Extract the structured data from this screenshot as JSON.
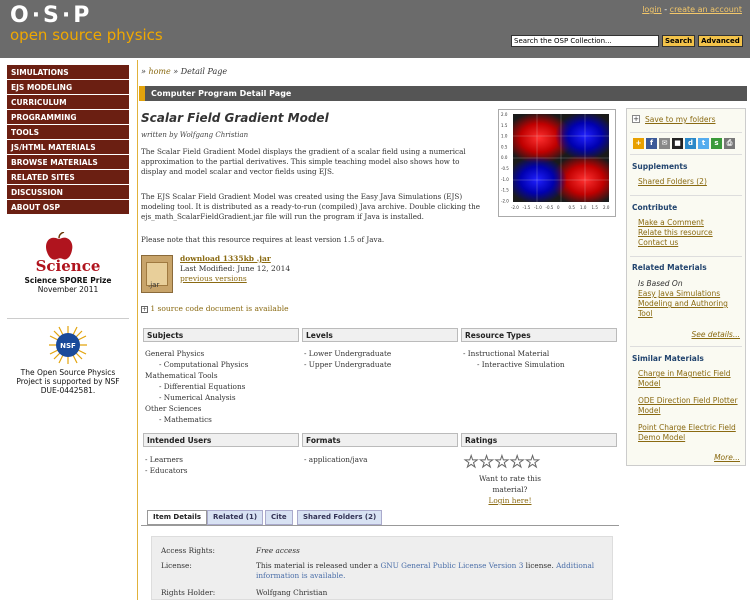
{
  "header": {
    "logo_text": "O·S·P",
    "logo_sub": "open source physics",
    "login": "login",
    "sep": " - ",
    "create_account": "create an account",
    "search_value": "Search the OSP Collection...",
    "search_button": "Search",
    "advanced_button": "Advanced"
  },
  "nav": [
    "SIMULATIONS",
    "EJS MODELING",
    "CURRICULUM",
    "PROGRAMMING",
    "TOOLS",
    "JS/HTML MATERIALS",
    "BROWSE MATERIALS",
    "RELATED SITES",
    "DISCUSSION",
    "ABOUT OSP"
  ],
  "award": {
    "logo_text": "Science",
    "line1": "Science SPORE Prize",
    "line2": "November 2011"
  },
  "nsf": {
    "logo_text": "NSF",
    "text1": "The Open Source Physics",
    "text2": "Project is supported by NSF",
    "text3": "DUE-0442581."
  },
  "breadcrumb": {
    "prefix": "» ",
    "home": "home",
    "rest": " » Detail Page"
  },
  "section_title": "Computer Program Detail Page",
  "resource": {
    "title": "Scalar Field Gradient Model",
    "author": "written by Wolfgang Christian",
    "p1": "The Scalar Field Gradient Model displays the gradient of a scalar field using a numerical approximation to the partial derivatives.  This simple teaching model also shows how to display and model scalar and vector fields using EJS.",
    "p2": "The EJS Scalar Field Gradient Model was created using the Easy Java Simulations (EJS) modeling tool.  It is distributed as a ready-to-run (compiled) Java archive.  Double clicking the ejs_math_ScalarFieldGradient.jar file will run the program if Java is installed.",
    "p3": "Please note that this resource requires at least version 1.5 of Java.",
    "download": "download 1335kb .jar",
    "modified": "Last Modified: June 12, 2014",
    "prev": "previous versions",
    "jar_label": ".jar",
    "source": "1 source code document is available"
  },
  "columns": {
    "subjects_h": "Subjects",
    "levels_h": "Levels",
    "types_h": "Resource Types",
    "subjects": [
      {
        "t": "General Physics",
        "sub": false
      },
      {
        "t": "- Computational Physics",
        "sub": true
      },
      {
        "t": "Mathematical Tools",
        "sub": false
      },
      {
        "t": "- Differential Equations",
        "sub": true
      },
      {
        "t": "- Numerical Analysis",
        "sub": true
      },
      {
        "t": "Other Sciences",
        "sub": false
      },
      {
        "t": "- Mathematics",
        "sub": true
      }
    ],
    "levels": [
      "- Lower Undergraduate",
      "- Upper Undergraduate"
    ],
    "types": [
      "- Instructional Material",
      "- Interactive Simulation"
    ],
    "users_h": "Intended Users",
    "formats_h": "Formats",
    "ratings_h": "Ratings",
    "users": [
      "- Learners",
      "- Educators"
    ],
    "formats": [
      "- application/java"
    ],
    "want_rate": "Want to rate this material?",
    "login_here": "Login here!"
  },
  "tabs": [
    "Item Details",
    "Related (1)",
    "Cite",
    "Shared Folders (2)"
  ],
  "details": {
    "access_label": "Access Rights:",
    "access_val": "Free access",
    "license_label": "License:",
    "license_pre": "This material is released under a ",
    "license_link": "GNU General Public License Version 3",
    "license_mid": " license. ",
    "license_more": "Additional information is available.",
    "holder_label": "Rights Holder:",
    "holder_val": "Wolfgang Christian"
  },
  "right": {
    "save": "Save to my folders",
    "supplements": "Supplements",
    "shared": "Shared Folders (2)",
    "contribute": "Contribute",
    "comment": "Make a Comment",
    "relate": "Relate this resource",
    "contact": "Contact us",
    "related_h": "Related Materials",
    "based": "Is Based On",
    "ejs_link": "Easy Java Simulations Modeling and Authoring Tool",
    "see_details": "See details...",
    "similar_h": "Similar Materials",
    "sim1": "Charge in Magnetic Field Model",
    "sim2": "ODE Direction Field Plotter Model",
    "sim3": "Point Charge Electric Field Demo Model",
    "more": "More..."
  },
  "thumb_axis": {
    "yticks": [
      "2.0",
      "1.5",
      "1.0",
      "0.5",
      "0.0",
      "-0.5",
      "-1.0",
      "-1.5",
      "-2.0"
    ],
    "xticks": [
      "-2.0",
      "-1.5",
      "-1.0",
      "-0.5",
      "0",
      "0.5",
      "1.0",
      "1.5",
      "2.0"
    ]
  },
  "colors": {
    "nav_bg": "#6b1f12",
    "accent": "#e2a30c",
    "header_bg": "#6b6b6b"
  }
}
